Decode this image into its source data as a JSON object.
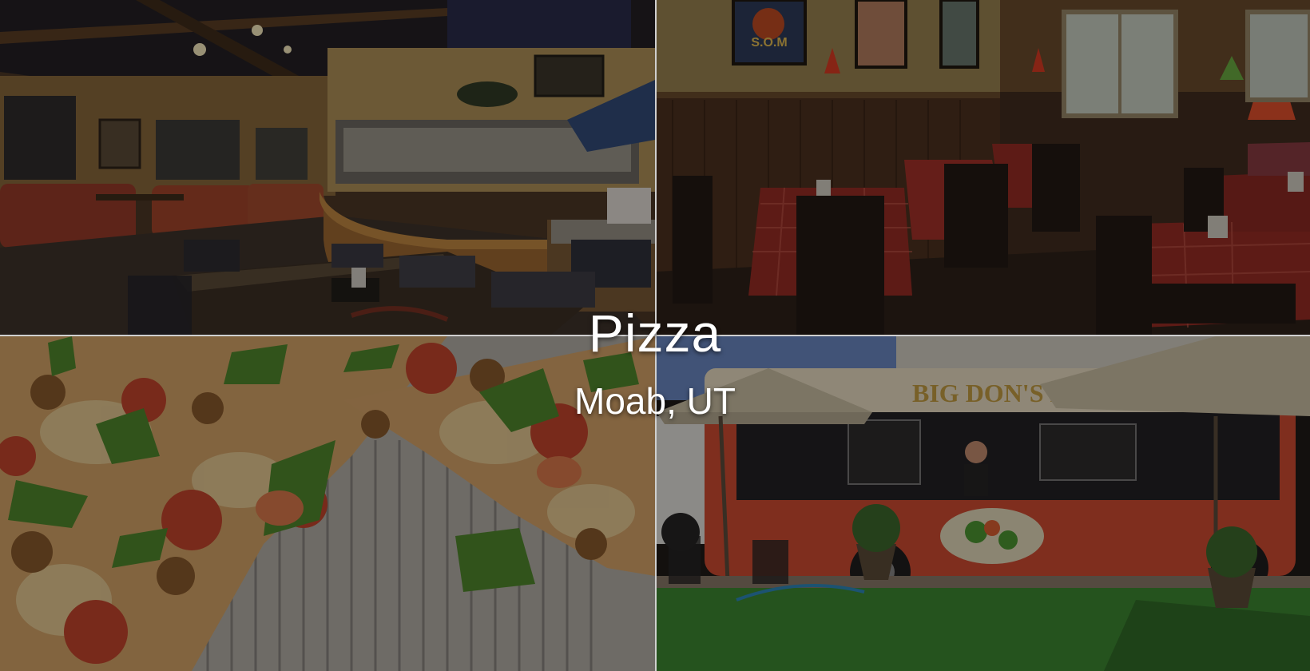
{
  "title": "Pizza",
  "subtitle": "Moab, UT",
  "photos": {
    "restaurant_bar": {
      "description_icon": "restaurant-bar-photo"
    },
    "dining_room": {
      "description_icon": "dining-room-photo",
      "poster_text": "S.O.M"
    },
    "pizza_closeup": {
      "description_icon": "pizza-closeup-photo"
    },
    "pizza_bus": {
      "description_icon": "pizza-bus-photo",
      "bus_sign": "BIG DON'S PIZZ"
    }
  },
  "colors": {
    "overlay_text": "#ffffff",
    "divider": "#cfcfcf"
  }
}
